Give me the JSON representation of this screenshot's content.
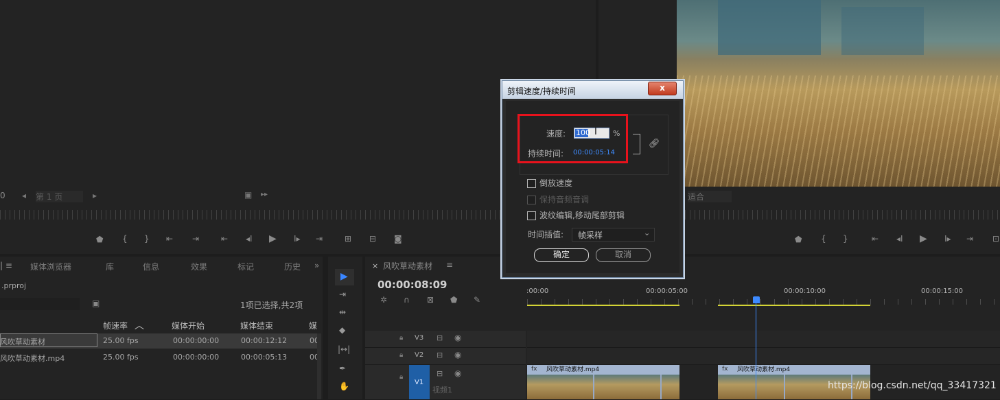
{
  "source_monitor": {
    "frame_counter": "0",
    "page_label": "第 1 页"
  },
  "program_monitor": {
    "fit_label": "适合"
  },
  "dialog": {
    "title": "剪辑速度/持续时间",
    "close": "x",
    "speed_label": "速度:",
    "speed_value": "100",
    "speed_unit": "%",
    "duration_label": "持续时间:",
    "duration_value": "00:00:05:14",
    "reverse_label": "倒放速度",
    "keep_pitch_label": "保持音频音调",
    "ripple_label": "波纹编辑,移动尾部剪辑",
    "interp_label": "时间插值:",
    "interp_value": "帧采样",
    "ok_label": "确定",
    "cancel_label": "取消"
  },
  "project_panel": {
    "tabs": [
      "媒体浏览器",
      "库",
      "信息",
      "效果",
      "标记",
      "历史"
    ],
    "project_file": ".prproj",
    "selection_info": "1项已选择,共2项",
    "columns": [
      "帧速率",
      "媒体开始",
      "媒体结束",
      "媒"
    ],
    "rows": [
      {
        "name": "风吹草动素材",
        "fps": "25.00 fps",
        "start": "00:00:00:00",
        "end": "00:00:12:12",
        "extra": "00"
      },
      {
        "name": "风吹草动素材.mp4",
        "fps": "25.00 fps",
        "start": "00:00:00:00",
        "end": "00:00:05:13",
        "extra": "00"
      }
    ]
  },
  "timeline": {
    "close": "×",
    "sequence_name": "风吹草动素材",
    "timecode": "00:00:08:09",
    "ruler_labels": [
      ":00:00",
      "00:00:05:00",
      "00:00:10:00",
      "00:00:15:00"
    ],
    "tracks": [
      "V3",
      "V2",
      "V1"
    ],
    "v1_label": "视频1",
    "clip1_title": "风吹草动素材.mp4",
    "clip2_title": "风吹草动素材.mp4"
  },
  "watermark": "https://blog.csdn.net/qq_33417321"
}
